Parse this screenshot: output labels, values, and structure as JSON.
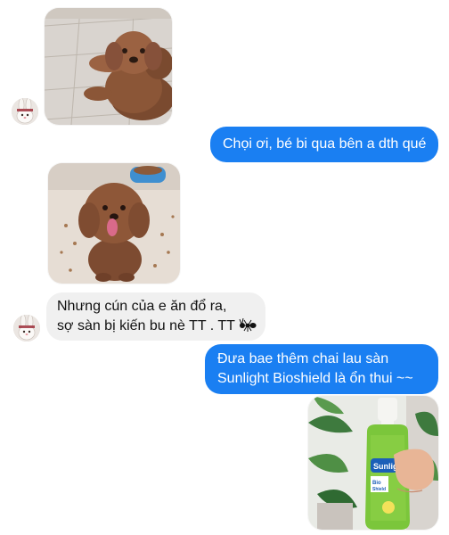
{
  "conversation": {
    "messages": [
      {
        "sender": "me",
        "text": "Chọi ơi, bé bi qua bên a dth qué"
      },
      {
        "sender": "them",
        "lines": [
          "Nhưng cún của e ăn đổ ra,",
          "sợ sàn bị kiến bu nè TT . TT"
        ],
        "icon": "ant-icon"
      },
      {
        "sender": "me",
        "lines": [
          "Đưa bae thêm chai lau sàn",
          "Sunlight Bioshield là ổn thui ~~"
        ]
      }
    ],
    "photos": [
      {
        "sender": "them",
        "description_icon": "poodle-lying-photo"
      },
      {
        "sender": "them",
        "description_icon": "poodle-sitting-photo"
      },
      {
        "sender": "me",
        "description_icon": "sunlight-bottle-photo"
      }
    ],
    "bottle_label": {
      "brand": "Sunlight",
      "line1": "Bio",
      "line2": "Shield"
    }
  },
  "colors": {
    "outgoing_bubble": "#1a7ff2",
    "incoming_bubble": "#f0f0f0"
  }
}
